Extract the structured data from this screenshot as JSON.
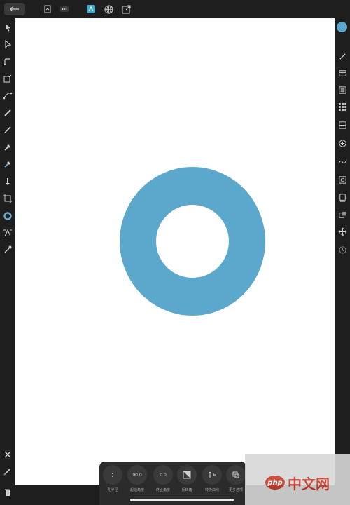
{
  "colors": {
    "accent": "#5aaad0",
    "shape_fill": "#5ca8cc",
    "canvas": "#ffffff",
    "chrome": "#1e1e1e"
  },
  "topbar": {
    "icons": [
      "back-icon",
      "document-icon",
      "more-icon",
      "persona-vector-icon",
      "persona-globe-icon",
      "persona-export-icon"
    ]
  },
  "left_tools": [
    "move-tool-icon",
    "node-tool-icon",
    "corner-tool-icon",
    "point-transform-icon",
    "pen-tool-icon",
    "pencil-tool-icon",
    "vector-brush-icon",
    "fill-tool-icon",
    "transparency-tool-icon",
    "place-image-icon",
    "artboard-tool-icon",
    "donut-shape-icon",
    "text-tool-icon",
    "color-picker-icon",
    "close-icon",
    "undo-icon",
    "trash-icon"
  ],
  "right_tools": [
    "color-panel-icon",
    "brush-panel-icon",
    "layers-panel-icon",
    "fx-panel-icon",
    "swatches-panel-icon",
    "stroke-panel-icon",
    "transform-panel-icon",
    "glyph-panel-icon",
    "navigator-panel-icon",
    "history-panel-icon",
    "snapping-panel-icon",
    "constraints-panel-icon",
    "settings-panel-icon"
  ],
  "context_toolbar": {
    "items": [
      {
        "label": "孔半径",
        "value": ""
      },
      {
        "label": "起始角度",
        "value": "90.0"
      },
      {
        "label": "终止角度",
        "value": "0.0"
      },
      {
        "label": "反转角",
        "value": ""
      },
      {
        "label": "转换曲线",
        "value": ""
      },
      {
        "label": "更多选项",
        "value": ""
      }
    ]
  },
  "watermark": {
    "badge": "php",
    "text": "中文网"
  }
}
